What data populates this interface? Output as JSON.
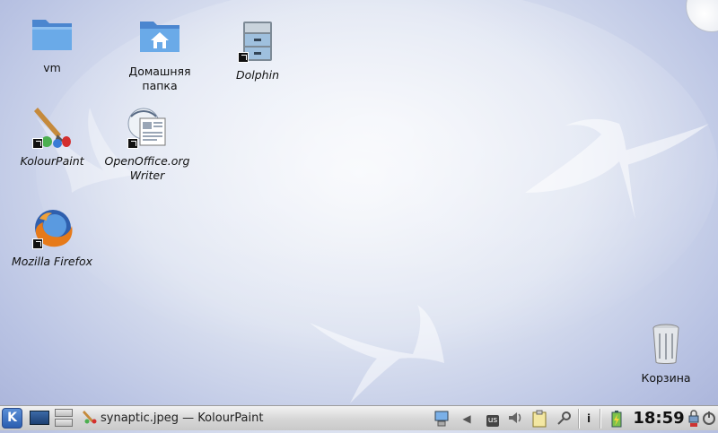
{
  "desktop": {
    "icons": [
      {
        "label": "vm",
        "icon": "folder-icon"
      },
      {
        "label": "Домашняя папка",
        "icon": "home-folder-icon"
      },
      {
        "label": "Dolphin",
        "icon": "file-cabinet-icon"
      },
      {
        "label": "KolourPaint",
        "icon": "paintbrush-icon"
      },
      {
        "label": "OpenOffice.org Writer",
        "icon": "writer-document-icon"
      },
      {
        "label": "Mozilla Firefox",
        "icon": "firefox-icon"
      },
      {
        "label": "Корзина",
        "icon": "trash-icon"
      }
    ]
  },
  "panel": {
    "kmenu_label": "K",
    "task": {
      "label": "synaptic.jpeg — KolourPaint"
    },
    "tray": {
      "keyboard_layout": "us",
      "info_label": "i"
    },
    "clock": "18:59"
  },
  "colors": {
    "folder": "#5e9ee0",
    "panel_top": "#f2f2f2",
    "panel_bottom": "#c9c9c9",
    "kmenu": "#2a5db0"
  }
}
